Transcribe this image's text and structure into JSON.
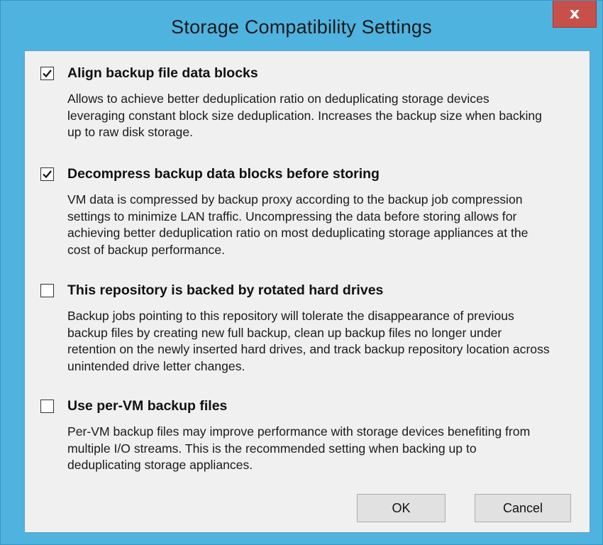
{
  "window": {
    "title": "Storage Compatibility Settings",
    "close_label": "x"
  },
  "options": [
    {
      "label": "Align backup file data blocks",
      "checked": true,
      "description": "Allows to achieve better deduplication ratio on deduplicating storage devices leveraging constant block size deduplication. Increases the backup size when backing up to raw disk storage."
    },
    {
      "label": "Decompress backup data blocks before storing",
      "checked": true,
      "description": "VM data is compressed by backup proxy according to the backup job compression settings to minimize LAN traffic. Uncompressing the data before storing allows for achieving better deduplication ratio on most deduplicating storage appliances at the cost of backup performance."
    },
    {
      "label": "This repository is backed by rotated hard drives",
      "checked": false,
      "description": "Backup jobs pointing to this repository will tolerate the disappearance of previous backup files by creating new full backup, clean up backup files no longer under retention on the newly inserted hard drives, and track backup repository location across unintended drive letter changes."
    },
    {
      "label": "Use per-VM backup files",
      "checked": false,
      "description": "Per-VM backup files may improve performance with storage devices benefiting from multiple I/O streams. This is the recommended setting when backing up to deduplicating storage appliances."
    }
  ],
  "buttons": {
    "ok_label": "OK",
    "cancel_label": "Cancel"
  },
  "colors": {
    "frame": "#4fb3e0",
    "close": "#c7504a",
    "client_bg": "#f0f0f0"
  }
}
